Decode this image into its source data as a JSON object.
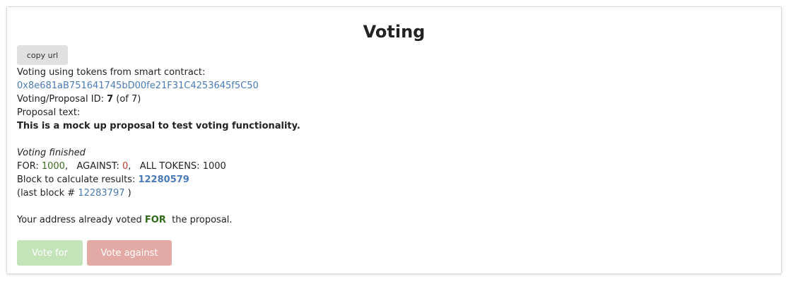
{
  "title": "Voting",
  "copy_url_label": "copy url",
  "contract": {
    "label": "Voting using tokens from smart contract:",
    "address": "0x8e681aB751641745bD00fe21F31C4253645f5C50"
  },
  "proposal": {
    "id_label": "Voting/Proposal ID: ",
    "id": "7",
    "of_text": "(of 7)",
    "text_label": "Proposal text:",
    "text": "This is a mock up proposal to test voting functionality."
  },
  "status": {
    "state": "Voting finished",
    "for_label": "FOR: ",
    "for_value": "1000",
    "against_label": "AGAINST: ",
    "against_value": "0",
    "all_label": "ALL TOKENS: ",
    "all_value": "1000",
    "block_label": "Block to calculate results: ",
    "block_value": "12280579",
    "last_block_prefix": "(last block # ",
    "last_block_value": "12283797",
    "last_block_suffix": " )"
  },
  "vote_message": {
    "prefix": "Your address already voted ",
    "choice": "FOR",
    "suffix": "  the proposal."
  },
  "buttons": {
    "vote_for": "Vote for",
    "vote_against": "Vote against"
  },
  "colors": {
    "link": "#4a7ab8",
    "for_green": "#3a6e1e",
    "against_red": "#c0392b",
    "vote_for_bg": "#c3e3b9",
    "vote_against_bg": "#e3aaa5"
  }
}
